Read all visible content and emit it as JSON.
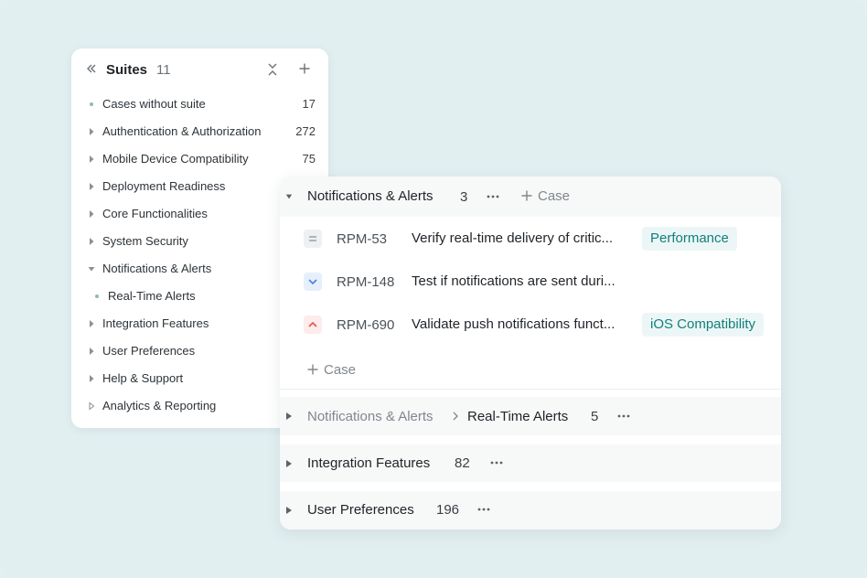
{
  "suites_panel": {
    "title": "Suites",
    "count": "11",
    "icons": {
      "collapse": "double-chevron-left-icon",
      "fold": "fold-icon",
      "add": "plus-icon"
    },
    "items": [
      {
        "label": "Cases without suite",
        "count": "17",
        "marker": "dot"
      },
      {
        "label": "Authentication & Authorization",
        "count": "272",
        "marker": "caret-right"
      },
      {
        "label": "Mobile Device Compatibility",
        "count": "75",
        "marker": "caret-right"
      },
      {
        "label": "Deployment Readiness",
        "count": "",
        "marker": "caret-right"
      },
      {
        "label": "Core Functionalities",
        "count": "",
        "marker": "caret-right"
      },
      {
        "label": "System Security",
        "count": "",
        "marker": "caret-right"
      },
      {
        "label": "Notifications & Alerts",
        "count": "",
        "marker": "caret-down"
      },
      {
        "label": "Real-Time Alerts",
        "count": "",
        "marker": "dot",
        "child": true
      },
      {
        "label": "Integration Features",
        "count": "",
        "marker": "caret-right"
      },
      {
        "label": "User Preferences",
        "count": "",
        "marker": "caret-right"
      },
      {
        "label": "Help & Support",
        "count": "",
        "marker": "caret-right"
      },
      {
        "label": "Analytics & Reporting",
        "count": "",
        "marker": "caret-right-outline"
      }
    ]
  },
  "main_panel": {
    "expanded_group": {
      "name": "Notifications & Alerts",
      "count": "3",
      "add_case_label": "Case"
    },
    "cases": [
      {
        "id": "RPM-53",
        "title": "Verify real-time delivery of critic...",
        "tag": "Performance",
        "priority": "normal",
        "priority_color": "#f0f1f2"
      },
      {
        "id": "RPM-148",
        "title": "Test if notifications are sent duri...",
        "tag": "",
        "priority": "low",
        "priority_color": "#e8f0fd"
      },
      {
        "id": "RPM-690",
        "title": "Validate push notifications funct...",
        "tag": "iOS Compatibility",
        "priority": "high",
        "priority_color": "#fdeceb"
      }
    ],
    "add_case_label": "Case",
    "collapsed_groups": [
      {
        "parent": "Notifications & Alerts",
        "name": "Real-Time Alerts",
        "count": "5"
      },
      {
        "parent": "",
        "name": "Integration Features",
        "count": "82"
      },
      {
        "parent": "",
        "name": "User Preferences",
        "count": "196"
      }
    ]
  },
  "colors": {
    "background": "#e2eff1",
    "tag_bg": "#edf6f6",
    "tag_text": "#11807c",
    "priority_low": "#4a7fe0",
    "priority_high": "#e0574a"
  }
}
